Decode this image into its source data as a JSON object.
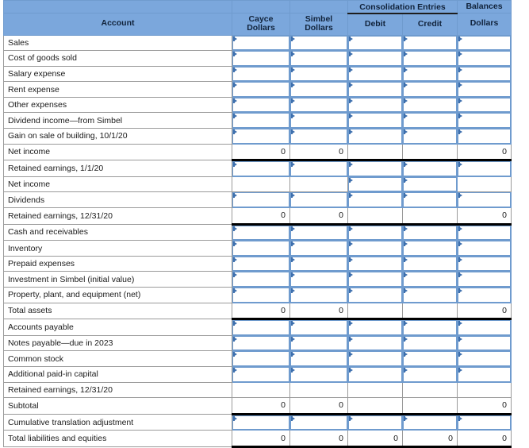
{
  "header": {
    "group_label": "Consolidation Entries",
    "balances_label": "Balances",
    "account_label": "Account",
    "columns": [
      {
        "key": "cayce",
        "line1": "Cayce",
        "line2": "Dollars"
      },
      {
        "key": "simbel",
        "line1": "Simbel",
        "line2": "Dollars"
      },
      {
        "key": "debit",
        "line1": "Debit",
        "line2": ""
      },
      {
        "key": "credit",
        "line1": "Credit",
        "line2": ""
      },
      {
        "key": "balance",
        "line1": "Dollars",
        "line2": ""
      }
    ]
  },
  "colors": {
    "header_bg": "#7BA7DC",
    "header_border": "#6F9BCE",
    "input_border": "#6F9BCE",
    "input_marker": "#3D6FAD",
    "grid": "#9A9A9A",
    "total_rule": "#000000"
  },
  "rows": [
    {
      "label": "Sales",
      "type": "input",
      "cells": [
        "input",
        "input",
        "input",
        "input",
        "input"
      ]
    },
    {
      "label": "Cost of goods sold",
      "type": "input",
      "cells": [
        "input",
        "input",
        "input",
        "input",
        "input"
      ]
    },
    {
      "label": "Salary expense",
      "type": "input",
      "cells": [
        "input",
        "input",
        "input",
        "input",
        "input"
      ]
    },
    {
      "label": "Rent expense",
      "type": "input",
      "cells": [
        "input",
        "input",
        "input",
        "input",
        "input"
      ]
    },
    {
      "label": "Other expenses",
      "type": "input",
      "cells": [
        "input",
        "input",
        "input",
        "input",
        "input"
      ]
    },
    {
      "label": "Dividend income—from Simbel",
      "type": "input",
      "cells": [
        "input",
        "input",
        "input",
        "input",
        "input"
      ]
    },
    {
      "label": "Gain on sale of building, 10/1/20",
      "type": "input",
      "cells": [
        "input",
        "input",
        "input",
        "input",
        "input"
      ]
    },
    {
      "label": "Net income",
      "type": "total",
      "cells": [
        "0",
        "0",
        "",
        "",
        "0"
      ]
    },
    {
      "label": "Retained earnings, 1/1/20",
      "type": "input",
      "cells": [
        "input",
        "input",
        "input",
        "input",
        "input"
      ]
    },
    {
      "label": "Net income",
      "type": "input",
      "cells": [
        "blank",
        "blank",
        "input",
        "input",
        "blank"
      ]
    },
    {
      "label": "Dividends",
      "type": "input",
      "cells": [
        "input",
        "input",
        "input",
        "input",
        "input"
      ]
    },
    {
      "label": "Retained earnings, 12/31/20",
      "type": "total",
      "cells": [
        "0",
        "0",
        "",
        "",
        "0"
      ]
    },
    {
      "label": "Cash and receivables",
      "type": "input",
      "cells": [
        "input",
        "input",
        "input",
        "input",
        "input"
      ]
    },
    {
      "label": "Inventory",
      "type": "input",
      "cells": [
        "input",
        "input",
        "input",
        "input",
        "input"
      ]
    },
    {
      "label": "Prepaid expenses",
      "type": "input",
      "cells": [
        "input",
        "input",
        "input",
        "input",
        "input"
      ]
    },
    {
      "label": "Investment in Simbel (initial value)",
      "type": "input",
      "cells": [
        "input",
        "input",
        "input",
        "input",
        "input"
      ]
    },
    {
      "label": "Property, plant, and equipment (net)",
      "type": "input",
      "cells": [
        "input",
        "input",
        "input",
        "input",
        "input"
      ]
    },
    {
      "label": "Total assets",
      "type": "total",
      "cells": [
        "0",
        "0",
        "",
        "",
        "0"
      ]
    },
    {
      "label": "Accounts payable",
      "type": "input",
      "cells": [
        "input",
        "input",
        "input",
        "input",
        "input"
      ]
    },
    {
      "label": "Notes payable—due in 2023",
      "type": "input",
      "cells": [
        "input",
        "input",
        "input",
        "input",
        "input"
      ]
    },
    {
      "label": "Common stock",
      "type": "input",
      "cells": [
        "input",
        "input",
        "input",
        "input",
        "input"
      ]
    },
    {
      "label": "Additional paid-in capital",
      "type": "input",
      "cells": [
        "input",
        "input",
        "input",
        "input",
        "input"
      ]
    },
    {
      "label": "Retained earnings, 12/31/20",
      "type": "plain",
      "cells": [
        "blank",
        "blank",
        "blank",
        "blank",
        "blank"
      ]
    },
    {
      "label": "Subtotal",
      "type": "total",
      "cells": [
        "0",
        "0",
        "",
        "",
        "0"
      ]
    },
    {
      "label": "Cumulative translation adjustment",
      "type": "input",
      "cells": [
        "input",
        "input",
        "input",
        "input",
        "input"
      ]
    },
    {
      "label": "Total liabilities and equities",
      "type": "total",
      "cells": [
        "0",
        "0",
        "0",
        "0",
        "0"
      ]
    }
  ]
}
